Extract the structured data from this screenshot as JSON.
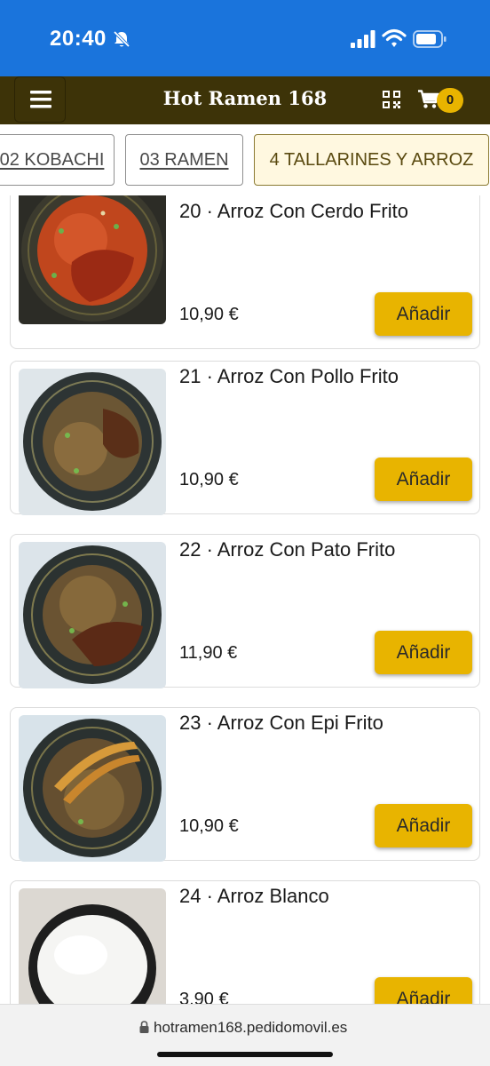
{
  "status_bar": {
    "time": "20:40"
  },
  "header": {
    "title": "Hot Ramen 168",
    "cart_count": "0"
  },
  "tabs": [
    {
      "label": "02 KOBACHI"
    },
    {
      "label": "03 RAMEN"
    },
    {
      "label": "4 TALLARINES Y ARROZ"
    }
  ],
  "products": [
    {
      "name": "20 · Arroz Con Cerdo Frito",
      "price": "10,90 €",
      "add_label": "Añadir"
    },
    {
      "name": "21 · Arroz Con Pollo Frito",
      "price": "10,90 €",
      "add_label": "Añadir"
    },
    {
      "name": "22 · Arroz Con Pato Frito",
      "price": "11,90 €",
      "add_label": "Añadir"
    },
    {
      "name": "23 · Arroz Con Epi Frito",
      "price": "10,90 €",
      "add_label": "Añadir"
    },
    {
      "name": "24 · Arroz Blanco",
      "price": "3,90 €",
      "add_label": "Añadir"
    }
  ],
  "browser": {
    "url": "hotramen168.pedidomovil.es"
  },
  "colors": {
    "status_bar": "#1a74dc",
    "header": "#3d3308",
    "accent": "#e8b400"
  }
}
